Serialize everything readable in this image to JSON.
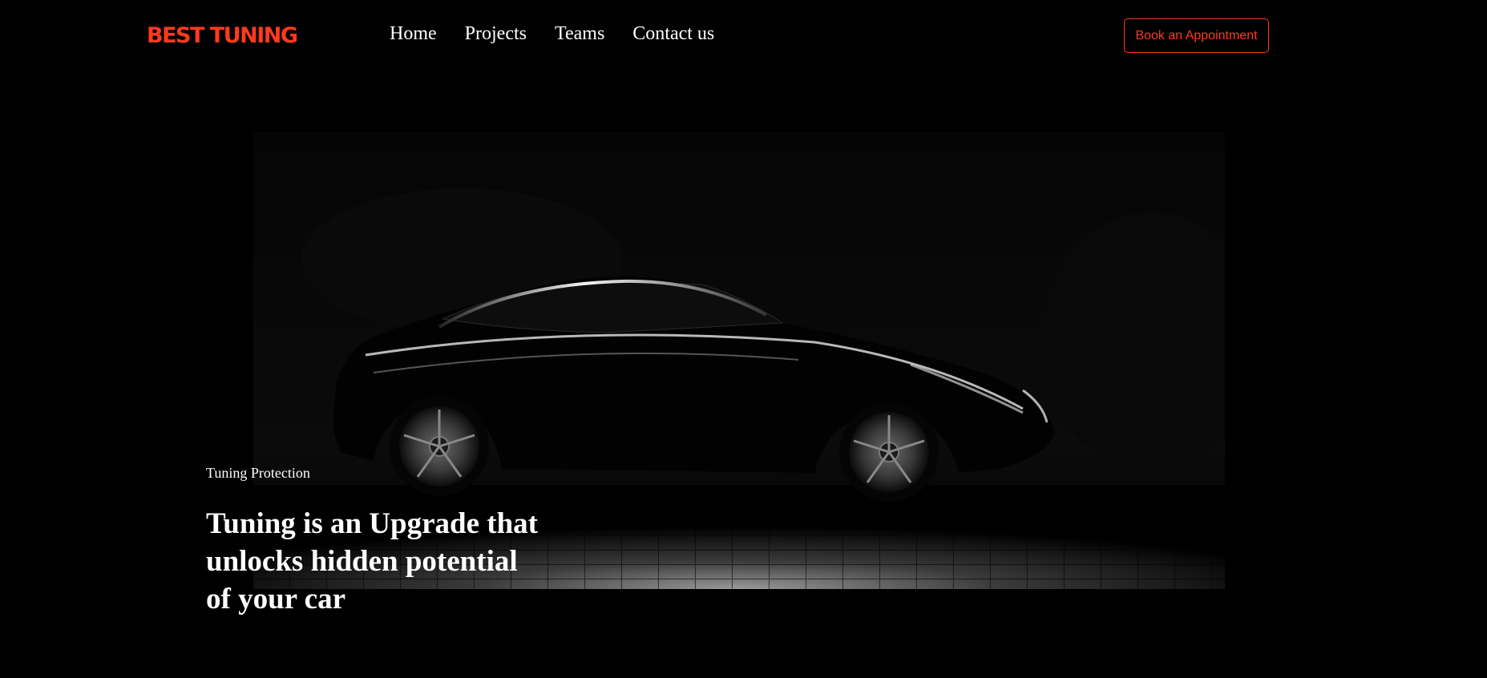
{
  "header": {
    "logo_text": "BEST TUNING",
    "nav_items": [
      "Home",
      "Projects",
      "Teams",
      "Contact us"
    ],
    "cta_label": "Book an Appointment"
  },
  "hero": {
    "eyebrow": "Tuning Protection",
    "headline": "Tuning is an Upgrade that unlocks hidden potential of your car",
    "image": "car-silhouette-image"
  },
  "colors": {
    "background": "#000000",
    "accent": "#ff3a1d",
    "text": "#ffffff"
  }
}
